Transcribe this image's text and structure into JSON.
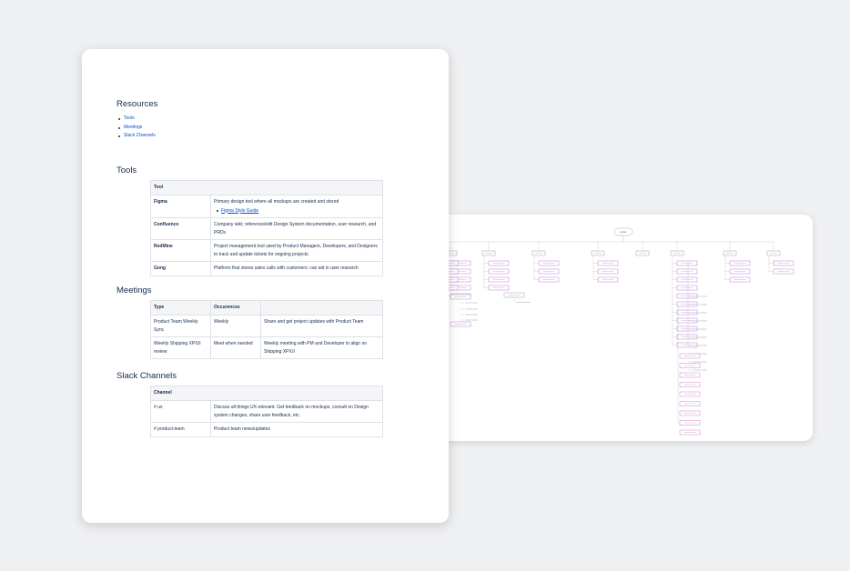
{
  "resources": {
    "title": "Resources",
    "links": [
      "Tools",
      "Meetings",
      "Slack Channels"
    ]
  },
  "tools": {
    "title": "Tools",
    "header": "Tool",
    "rows": [
      {
        "name": "Figma",
        "desc": "Primary design tool where all mockups are created and stored",
        "link": "Figma Style Guide"
      },
      {
        "name": "Confluence",
        "desc": "Company wiki; reference/edit Design System documentation, user research, and PRDs"
      },
      {
        "name": "RedMine",
        "desc": "Project management tool used by Product Managers, Developers, and Designers to track and update tickets for ongoing projects"
      },
      {
        "name": "Gong",
        "desc": "Platform that stores sales calls with customers; can aid in user research"
      }
    ]
  },
  "meetings": {
    "title": "Meetings",
    "headers": [
      "Type",
      "Occurences",
      ""
    ],
    "rows": [
      {
        "type": "Product Team Weekly Sync",
        "occurrence": "Weekly",
        "desc": "Share and get project updates with Product Team"
      },
      {
        "type": "Weekly Shipping XP/UI review",
        "occurrence": "Meet when needed",
        "desc": "Weekly meeting with PM and Developer to align on Shipping XP/UI"
      }
    ]
  },
  "slack": {
    "title": "Slack Channels",
    "header": "Channel",
    "rows": [
      {
        "channel": "# ux",
        "desc": "Discuss all things UX-relevant. Get feedback on mockups, consult on Design system changes, share user feedback, etc."
      },
      {
        "channel": "# product-team",
        "desc": "Product team news/updates"
      }
    ]
  },
  "sitemap": {
    "root": "Home"
  }
}
